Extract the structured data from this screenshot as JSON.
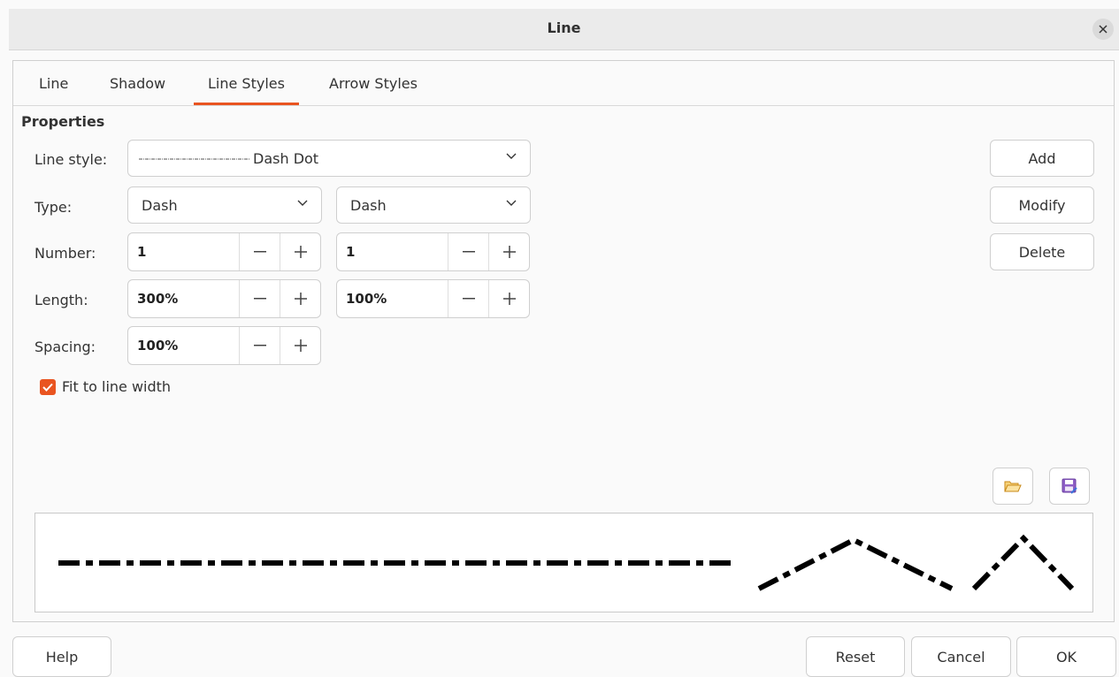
{
  "window": {
    "title": "Line"
  },
  "tabs": [
    {
      "label": "Line"
    },
    {
      "label": "Shadow"
    },
    {
      "label": "Line Styles",
      "active": true
    },
    {
      "label": "Arrow Styles"
    }
  ],
  "properties": {
    "section_title": "Properties",
    "line_style": {
      "label": "Line style:",
      "value": "Dash Dot"
    },
    "type": {
      "label": "Type:",
      "value1": "Dash",
      "value2": "Dash"
    },
    "number": {
      "label": "Number:",
      "value1": "1",
      "value2": "1"
    },
    "length": {
      "label": "Length:",
      "value1": "300%",
      "value2": "100%"
    },
    "spacing": {
      "label": "Spacing:",
      "value1": "100%"
    },
    "fit_to_line_width": {
      "label": "Fit to line width",
      "checked": true
    }
  },
  "side_buttons": {
    "add": "Add",
    "modify": "Modify",
    "delete": "Delete"
  },
  "footer": {
    "help": "Help",
    "reset": "Reset",
    "cancel": "Cancel",
    "ok": "OK"
  },
  "icons": {
    "load": "open-folder-icon",
    "save": "save-icon",
    "accent_color": "#e95420"
  }
}
